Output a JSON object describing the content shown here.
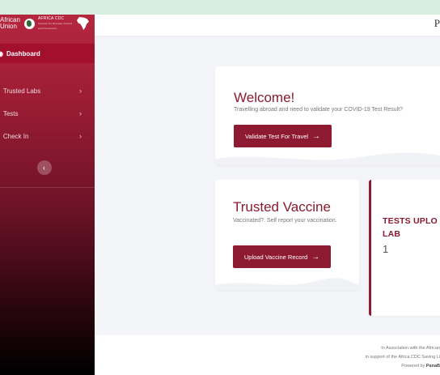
{
  "brand": {
    "au_line1": "African",
    "au_line2": "Union",
    "cdc_name": "AFRICA CDC",
    "cdc_sub": "Centres for Disease Control and Prevention"
  },
  "sidebar": {
    "active": {
      "label": "Dashboard",
      "icon": "dashboard-icon"
    },
    "items": [
      {
        "label": "Trusted Labs",
        "icon": "lab-icon"
      },
      {
        "label": "Tests",
        "icon": "test-icon"
      },
      {
        "label": "Check In",
        "icon": "check-in-icon"
      }
    ],
    "collapse_glyph": "‹"
  },
  "topbar": {
    "initial": "P"
  },
  "welcome": {
    "title": "Welcome!",
    "subtitle": "Travelling abroad and need to validate your COVID-19 Test Result?",
    "button": "Validate Test For Travel"
  },
  "vaccine": {
    "title": "Trusted Vaccine",
    "subtitle": "Vaccinated?. Self report your vaccination.",
    "button": "Upload Vaccine Record"
  },
  "tests_card": {
    "label_line1": "TESTS UPLO",
    "label_line2": "LAB",
    "count": "1"
  },
  "footer": {
    "line1": "In Association with the African",
    "line2": "In support of the Africa CDC Saving Li",
    "line3_prefix": "Powered by ",
    "line3_brand": "PanaB"
  },
  "colors": {
    "brand": "#8e1a31",
    "sidebar_top": "#b5273f",
    "background": "#f4f5f8"
  }
}
